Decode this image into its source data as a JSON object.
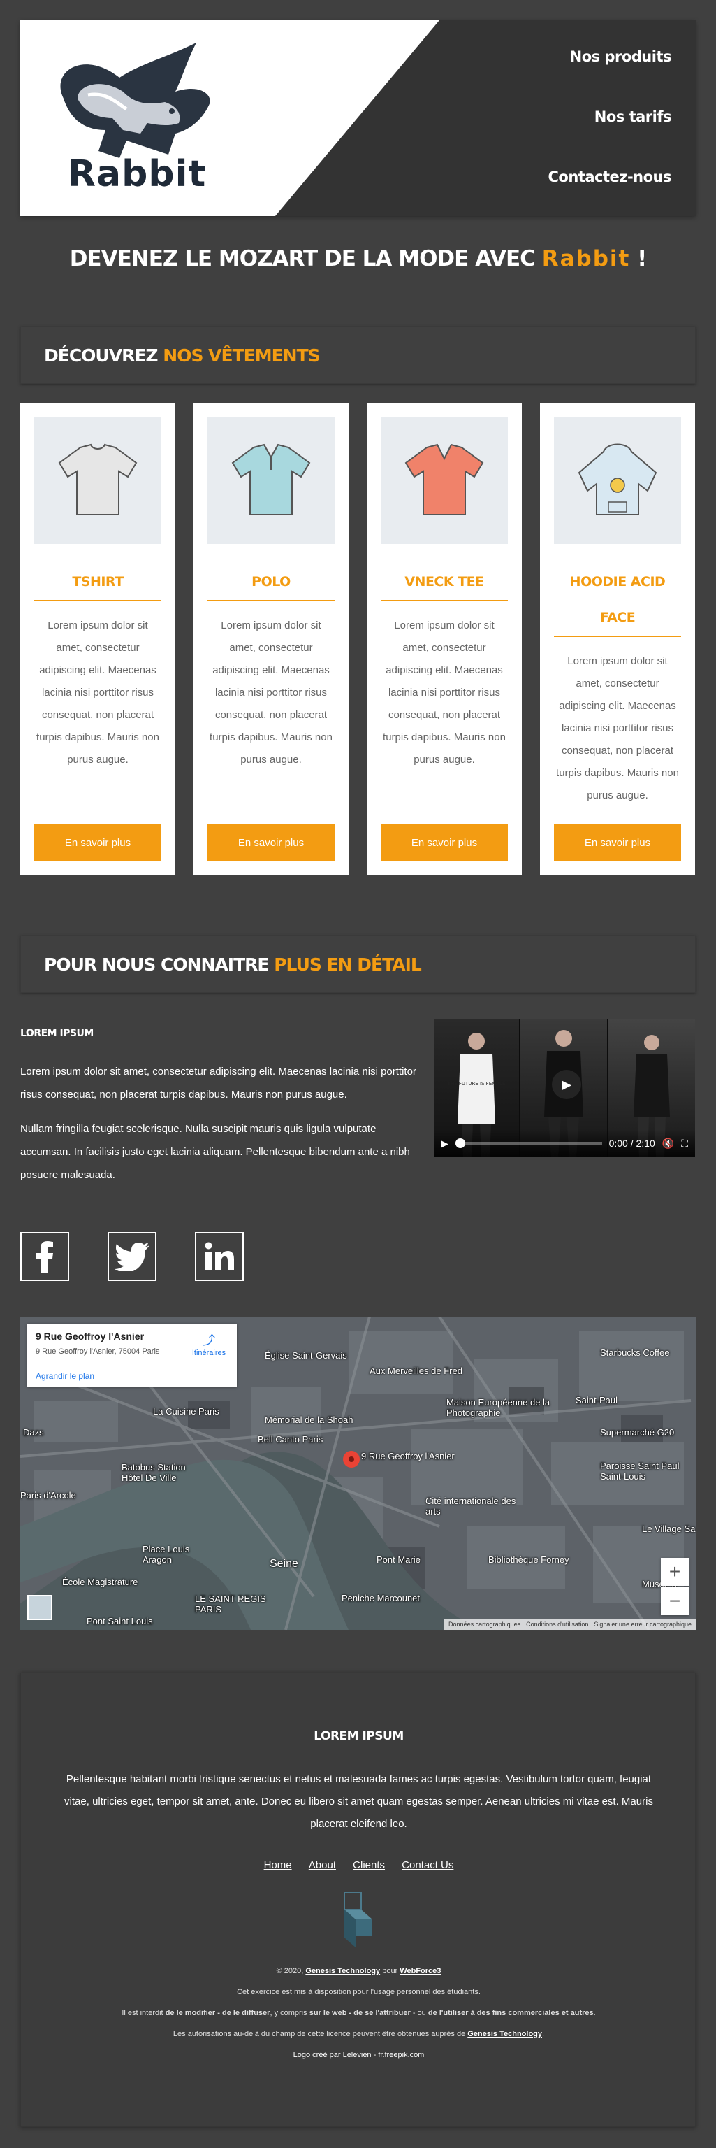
{
  "header": {
    "brand": "Rabbit",
    "nav": [
      "Nos produits",
      "Nos tarifs",
      "Contactez-nous"
    ]
  },
  "tagline": {
    "prefix": "DEVENEZ LE MOZART DE LA MODE AVEC",
    "brand": "Rabbit",
    "suffix": "!"
  },
  "products_section": {
    "title_a": "DÉCOUVREZ",
    "title_b": "NOS VÊTEMENTS"
  },
  "products": [
    {
      "title": "TSHIRT",
      "icon": "tshirt-icon",
      "color": "#e6e6e6",
      "desc": "Lorem ipsum dolor sit amet, consectetur adipiscing elit. Maecenas lacinia nisi porttitor risus consequat, non placerat turpis dapibus. Mauris non purus augue.",
      "button": "En savoir plus"
    },
    {
      "title": "POLO",
      "icon": "polo-icon",
      "color": "#a8d8de",
      "desc": "Lorem ipsum dolor sit amet, consectetur adipiscing elit. Maecenas lacinia nisi porttitor risus consequat, non placerat turpis dapibus. Mauris non purus augue.",
      "button": "En savoir plus"
    },
    {
      "title": "VNECK TEE",
      "icon": "vneck-icon",
      "color": "#f0826a",
      "desc": "Lorem ipsum dolor sit amet, consectetur adipiscing elit. Maecenas lacinia nisi porttitor risus consequat, non placerat turpis dapibus. Mauris non purus augue.",
      "button": "En savoir plus"
    },
    {
      "title": "HOODIE ACID FACE",
      "icon": "hoodie-icon",
      "color": "#d8e8f2",
      "desc": "Lorem ipsum dolor sit amet, consectetur adipiscing elit. Maecenas lacinia nisi porttitor risus consequat, non placerat turpis dapibus. Mauris non purus augue.",
      "button": "En savoir plus"
    }
  ],
  "detail_section": {
    "title_a": "POUR NOUS CONNAITRE",
    "title_b": "PLUS EN DÉTAIL",
    "heading": "LOREM IPSUM",
    "p1": "Lorem ipsum dolor sit amet, consectetur adipiscing elit. Maecenas lacinia nisi porttitor risus consequat, non placerat turpis dapibus. Mauris non purus augue.",
    "p2": "Nullam fringilla feugiat scelerisque. Nulla suscipit mauris quis ligula vulputate accumsan. In facilisis justo eget lacinia aliquam. Pellentesque bibendum ante a nibh posuere malesuada."
  },
  "video": {
    "time": "0:00 / 2:10",
    "shirt_text": "THE FUTURE IS FEMALE"
  },
  "social": [
    "facebook-icon",
    "twitter-icon",
    "linkedin-icon"
  ],
  "map": {
    "place_name": "9 Rue Geoffroy l'Asnier",
    "address": "9 Rue Geoffroy l'Asnier, 75004 Paris",
    "directions": "Itinéraires",
    "enlarge": "Agrandir le plan",
    "labels": {
      "eglise": "Église Saint-Gervais",
      "merveilles": "Aux Merveilles de Fred",
      "starbucks": "Starbucks Coffee",
      "maison_photo": "Maison Européenne de la Photographie",
      "saint_paul": "Saint-Paul",
      "cuisine": "La Cuisine Paris",
      "memorial": "Mémorial de la Shoah",
      "bell_canto": "Bell Canto Paris",
      "pin": "9 Rue Geoffroy l'Asnier",
      "supermarche": "Supermarché G20",
      "paroisse": "Paroisse Saint Paul Saint-Louis",
      "batobus": "Batobus Station Hôtel De Ville",
      "cite": "Cité internationale des arts",
      "arcole": "Paris d'Arcole",
      "pont_marie": "Pont Marie",
      "place_louis": "Place Louis Aragon",
      "seine": "Seine",
      "bibliotheque": "Bibliothèque Forney",
      "village": "Le Village Sa",
      "ecole": "École Magistrature",
      "saint_regis": "LE SAINT REGIS PARIS",
      "peniche": "Peniche Marcounet",
      "musee": "Musée d",
      "pont_louis": "Pont Saint Louis",
      "dazs": "Dazs"
    },
    "footer": [
      "Données cartographiques",
      "Conditions d'utilisation",
      "Signaler une erreur cartographique"
    ],
    "zoom_in": "+",
    "zoom_out": "−"
  },
  "footer": {
    "heading": "LOREM IPSUM",
    "text": "Pellentesque habitant morbi tristique senectus et netus et malesuada fames ac turpis egestas. Vestibulum tortor quam, feugiat vitae, ultricies eget, tempor sit amet, ante. Donec eu libero sit amet quam egestas semper. Aenean ultricies mi vitae est. Mauris placerat eleifend leo.",
    "links": [
      "Home",
      "About",
      "Clients",
      "Contact Us"
    ],
    "copy_pre": "© 2020,",
    "copy_org": "Genesis Technology",
    "copy_mid": "pour",
    "copy_client": "WebForce3",
    "line2": "Cet exercice est mis à disposition pour l'usage personnel des étudiants.",
    "line3_a": "Il est interdit",
    "line3_b": "de le modifier - de le diffuser",
    "line3_c": ", y compris",
    "line3_d": "sur le web - de se l'attribuer",
    "line3_e": "- ou",
    "line3_f": "de l'utiliser à des fins commerciales et autres",
    "line3_g": ".",
    "line4_pre": "Les autorisations au-delà du champ de cette licence peuvent être obtenues auprès de",
    "line4_org": "Genesis Technology",
    "line4_post": ".",
    "line5": "Logo créé par Lelevien - fr.freepik.com"
  },
  "colors": {
    "accent": "#f39c12",
    "background": "#404040",
    "header_dark": "#333333"
  }
}
